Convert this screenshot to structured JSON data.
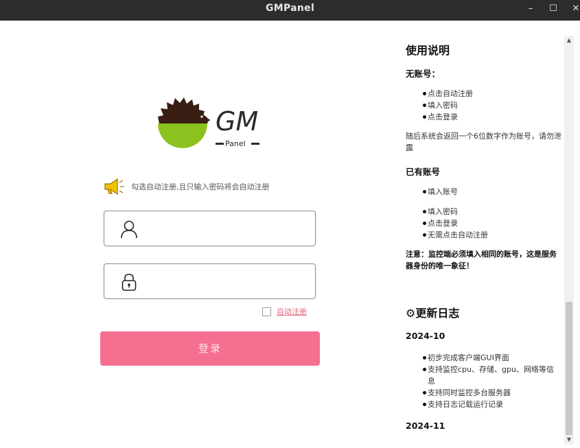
{
  "window": {
    "title": "GMPanel",
    "minimize": "–",
    "maximize": "☐",
    "close": "✕"
  },
  "logo": {
    "text": "GM",
    "subtext": "Panel"
  },
  "notice": {
    "text": "勾选自动注册,且只输入密码将会自动注册",
    "icon": "megaphone-icon"
  },
  "form": {
    "username": {
      "value": "",
      "placeholder": "",
      "icon": "user-icon"
    },
    "password": {
      "value": "",
      "placeholder": "",
      "icon": "lock-icon"
    },
    "auto_register_label": "自动注册",
    "auto_register_checked": false,
    "login_label": "登录"
  },
  "help": {
    "title": "使用说明",
    "no_account": {
      "heading": "无账号：",
      "steps": [
        "点击自动注册",
        "填入密码",
        "点击登录"
      ],
      "note": "随后系统会返回一个6位数字作为账号，请勿泄露"
    },
    "has_account": {
      "heading": "已有账号",
      "steps": [
        "填入账号",
        "填入密码",
        "点击登录",
        "无需点击自动注册"
      ],
      "warning_prefix": "注意：",
      "warning": "监控端必须填入相同的账号，这是服务器身份的唯一象征！"
    },
    "changelog_title": "⚙更新日志",
    "versions": [
      {
        "version": "2024-10",
        "items": [
          "初步完成客户端GUI界面",
          "支持监控cpu、存储、gpu、网络等信息",
          "支持同时监控多台服务器",
          "支持日志记载运行记录"
        ]
      },
      {
        "version": "2024-11",
        "items": []
      }
    ]
  },
  "colors": {
    "accent": "#f56f91",
    "link": "#e0697f",
    "titlebar": "#2c2c2c",
    "logo_green": "#8cc21f",
    "logo_brown": "#3a1e14"
  }
}
